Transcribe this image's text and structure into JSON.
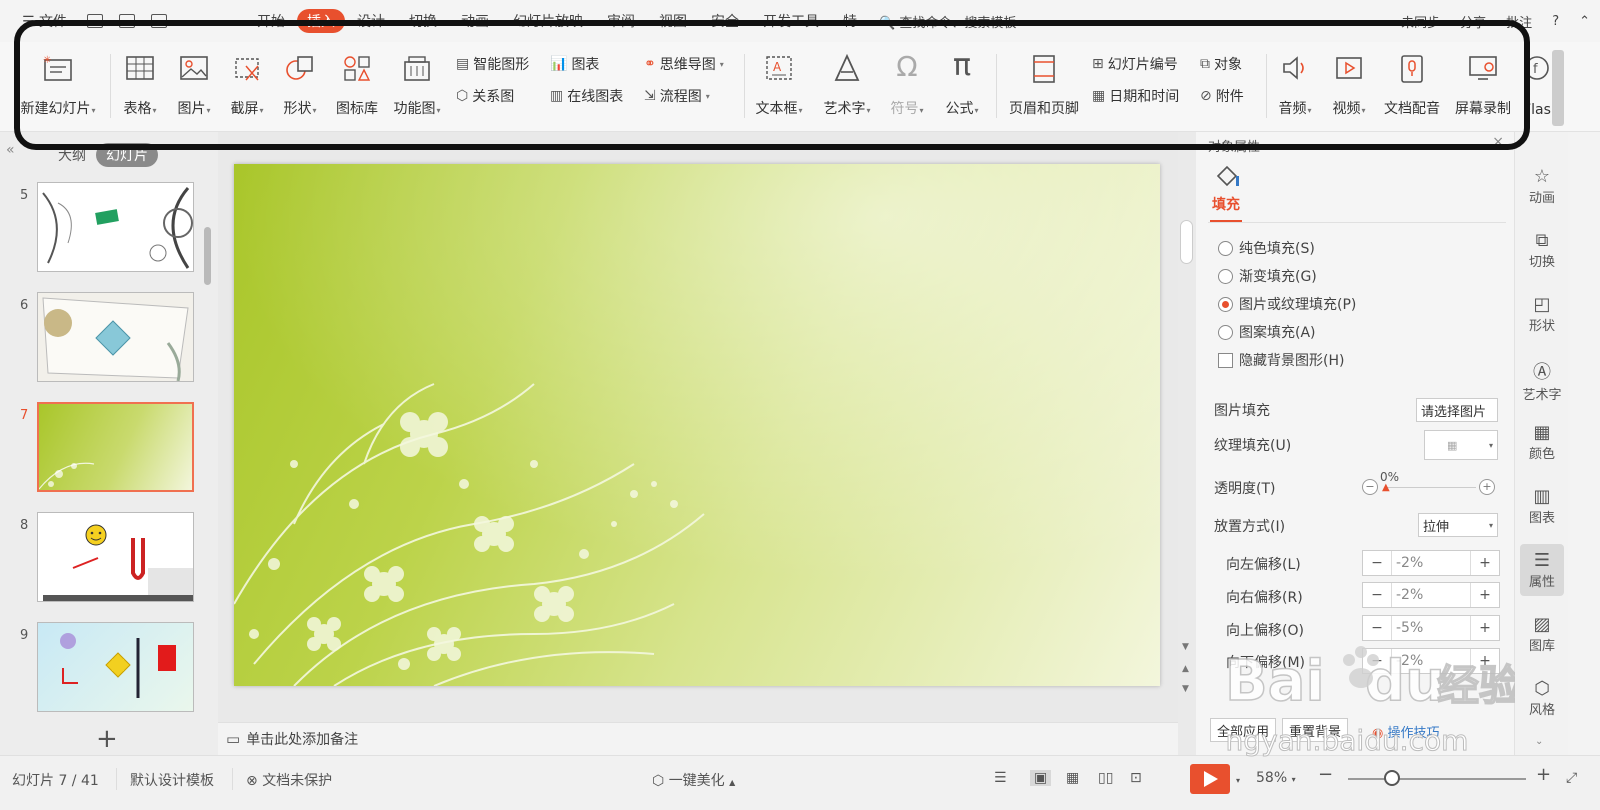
{
  "menubar": {
    "file_label": "文件",
    "tabs": [
      "开始",
      "插入",
      "设计",
      "切换",
      "动画",
      "幻灯片放映",
      "审阅",
      "视图",
      "安全",
      "开发工具",
      "特"
    ],
    "active_tab": "插入",
    "search_label": "查找命令、搜索模板",
    "sync_label": "未同步",
    "share_label": "分享",
    "comment_label": "批注"
  },
  "ribbon": {
    "new_slide": "新建幻灯片",
    "table": "表格",
    "picture": "图片",
    "screenshot": "截屏",
    "shape": "形状",
    "icon_lib": "图标库",
    "func_chart": "功能图",
    "smart_art": "智能图形",
    "chart": "图表",
    "relation": "关系图",
    "online_chart": "在线图表",
    "mind_map": "思维导图",
    "flowchart": "流程图",
    "textbox": "文本框",
    "wordart": "艺术字",
    "symbol": "符号",
    "formula": "公式",
    "header_footer": "页眉和页脚",
    "slide_number": "幻灯片编号",
    "object": "对象",
    "date_time": "日期和时间",
    "attachment": "附件",
    "audio": "音频",
    "video": "视频",
    "doc_voice": "文档配音",
    "screen_record": "屏幕录制",
    "flash": "Flas"
  },
  "leftpane": {
    "tab_outline": "大纲",
    "tab_slides": "幻灯片",
    "slides": [
      {
        "num": "5"
      },
      {
        "num": "6"
      },
      {
        "num": "7"
      },
      {
        "num": "8"
      },
      {
        "num": "9"
      }
    ],
    "selected": "7",
    "add": "+"
  },
  "notes": {
    "placeholder": "单击此处添加备注"
  },
  "props": {
    "title": "对象属性",
    "fill_tab": "填充",
    "options": [
      {
        "label": "纯色填充(S)",
        "checked": false
      },
      {
        "label": "渐变填充(G)",
        "checked": false
      },
      {
        "label": "图片或纹理填充(P)",
        "checked": true
      },
      {
        "label": "图案填充(A)",
        "checked": false
      }
    ],
    "hide_bg": "隐藏背景图形(H)",
    "picture_fill_label": "图片填充",
    "picture_fill_value": "请选择图片",
    "texture_fill_label": "纹理填充(U)",
    "transparency_label": "透明度(T)",
    "transparency_value": "0%",
    "placement_label": "放置方式(I)",
    "placement_value": "拉伸",
    "offsets": [
      {
        "label": "向左偏移(L)",
        "value": "-2%"
      },
      {
        "label": "向右偏移(R)",
        "value": "-2%"
      },
      {
        "label": "向上偏移(O)",
        "value": "-5%"
      },
      {
        "label": "向下偏移(M)",
        "value": "-2%"
      }
    ],
    "apply_all": "全部应用",
    "reset_bg": "重置背景",
    "tips": "操作技巧"
  },
  "sidestrip": [
    "动画",
    "切换",
    "形状",
    "艺术字",
    "颜色",
    "图表",
    "属性",
    "图库",
    "风格"
  ],
  "sidestrip_selected": "属性",
  "status": {
    "slide_info": "幻灯片 7 / 41",
    "template": "默认设计模板",
    "protection": "文档未保护",
    "beautify": "一键美化",
    "zoom": "58%"
  },
  "watermark": {
    "text1": "Baidu 经验",
    "text2": "jingyan.baidu.com"
  },
  "colors": {
    "accent": "#e8502e",
    "slide_green": "#a9c62a"
  }
}
